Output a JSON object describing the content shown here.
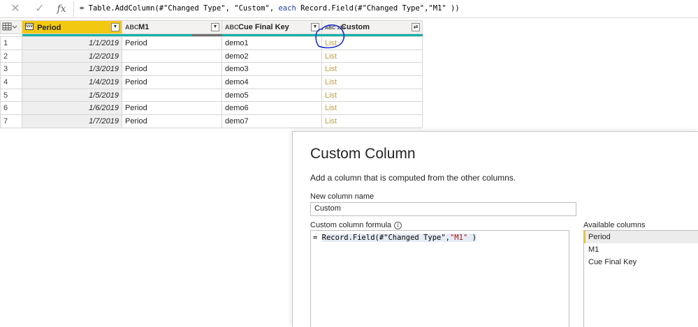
{
  "formula_bar": {
    "cancel_icon": "close-icon",
    "commit_icon": "check-icon",
    "fx_label": "fx",
    "formula_prefix": "= Table.AddColumn(#\"Changed Type\", \"Custom\", ",
    "formula_each": "each",
    "formula_suffix": " Record.Field(#\"Changed Type\",\"M1\" ))"
  },
  "grid": {
    "columns": [
      {
        "name": "Period",
        "type_label": ""
      },
      {
        "name": "M1",
        "type_label": "ABC"
      },
      {
        "name": "Cue Final Key",
        "type_label": "ABC"
      },
      {
        "name": "Custom",
        "type_label": "ABC 123"
      }
    ],
    "rows": [
      {
        "n": "1",
        "period": "1/1/2019",
        "m1": "Period",
        "key": "demo1",
        "custom": "List"
      },
      {
        "n": "2",
        "period": "1/2/2019",
        "m1": "",
        "key": "demo2",
        "custom": "List"
      },
      {
        "n": "3",
        "period": "1/3/2019",
        "m1": "Period",
        "key": "demo3",
        "custom": "List"
      },
      {
        "n": "4",
        "period": "1/4/2019",
        "m1": "Period",
        "key": "demo4",
        "custom": "List"
      },
      {
        "n": "5",
        "period": "1/5/2019",
        "m1": "",
        "key": "demo5",
        "custom": "List"
      },
      {
        "n": "6",
        "period": "1/6/2019",
        "m1": "Period",
        "key": "demo6",
        "custom": "List"
      },
      {
        "n": "7",
        "period": "1/7/2019",
        "m1": "Period",
        "key": "demo7",
        "custom": "List"
      }
    ],
    "accent_color": "#12b3a8"
  },
  "dialog": {
    "title": "Custom Column",
    "subtitle": "Add a column that is computed from the other columns.",
    "new_col_label": "New column name",
    "new_col_value": "Custom",
    "formula_label": "Custom column formula",
    "formula_eq": "= ",
    "formula_func": "Record.Field(#\"Changed Type\",",
    "formula_str": "\"M1\"",
    "formula_end": " )",
    "available_label": "Available columns",
    "available": [
      "Period",
      "M1",
      "Cue Final Key"
    ]
  }
}
